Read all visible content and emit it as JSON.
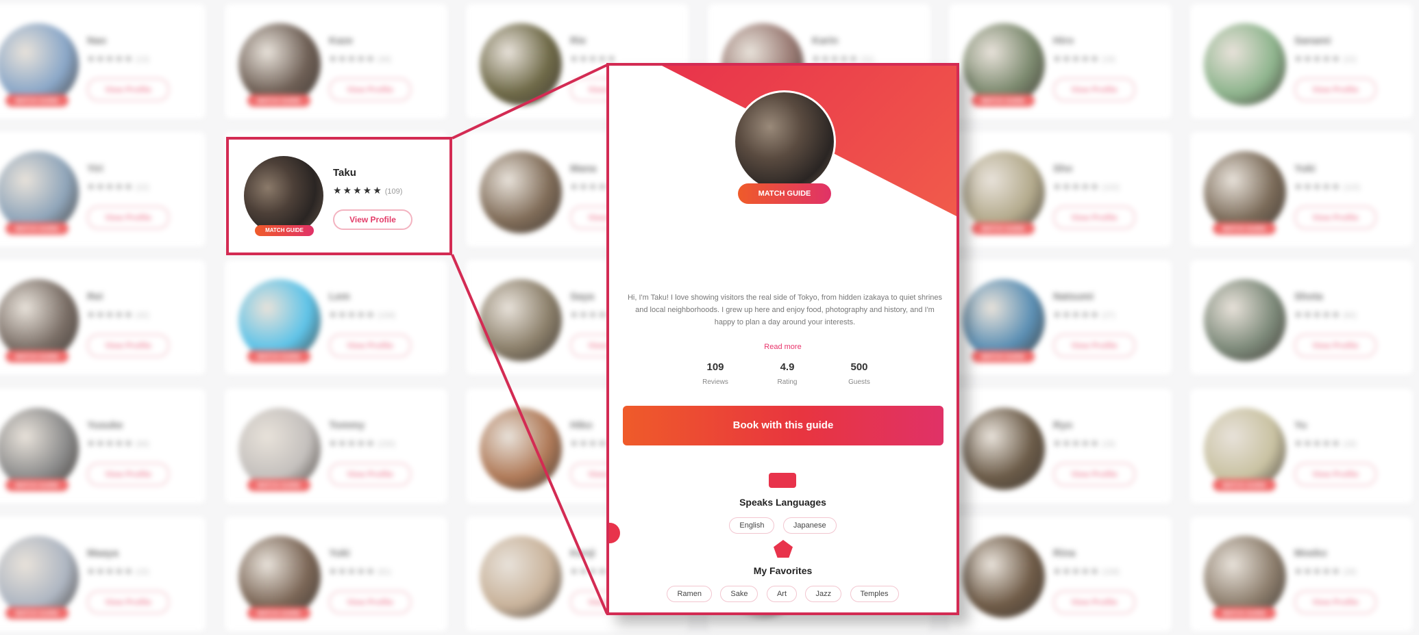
{
  "grid_cards": [
    {
      "name": "Nao",
      "reviews": "(13)",
      "badge": "MATCH GUIDE",
      "color": "#8aa7c8"
    },
    {
      "name": "Kaze",
      "reviews": "(46)",
      "badge": "MATCH GUIDE",
      "color": "#6e5f55"
    },
    {
      "name": "Rie",
      "reviews": "",
      "badge": "",
      "color": "#6f6a48"
    },
    {
      "name": "Karin",
      "reviews": "(31)",
      "badge": "",
      "color": "#9a7b74"
    },
    {
      "name": "Hiro",
      "reviews": "(19)",
      "badge": "MATCH GUIDE",
      "color": "#7c8a6f"
    },
    {
      "name": "Sanami",
      "reviews": "(22)",
      "badge": "",
      "color": "#8fb58e"
    },
    {
      "name": "Yiri",
      "reviews": "(22)",
      "badge": "MATCH GUIDE",
      "color": "#8fa5ba"
    },
    {
      "name": "Taku",
      "reviews": "(109)",
      "badge": "MATCH GUIDE",
      "color": "#4b3f38"
    },
    {
      "name": "Mana",
      "reviews": "",
      "badge": "",
      "color": "#806c58"
    },
    {
      "name": "",
      "reviews": "",
      "badge": "",
      "color": "#ffffff"
    },
    {
      "name": "Sho",
      "reviews": "(102)",
      "badge": "MATCH GUIDE",
      "color": "#b3aa8c"
    },
    {
      "name": "Yuki",
      "reviews": "(115)",
      "badge": "MATCH GUIDE",
      "color": "#7a6a58"
    },
    {
      "name": "Rei",
      "reviews": "(42)",
      "badge": "MATCH GUIDE",
      "color": "#7a6e66"
    },
    {
      "name": "Lem",
      "reviews": "(108)",
      "badge": "MATCH GUIDE",
      "color": "#5ec3e8"
    },
    {
      "name": "Saya",
      "reviews": "",
      "badge": "",
      "color": "#8b7f6a"
    },
    {
      "name": "",
      "reviews": "",
      "badge": "",
      "color": "#ffffff"
    },
    {
      "name": "Natsumi",
      "reviews": "(27)",
      "badge": "MATCH GUIDE",
      "color": "#5b8fb4"
    },
    {
      "name": "Shota",
      "reviews": "(82)",
      "badge": "",
      "color": "#7d8a7a"
    },
    {
      "name": "Yusuke",
      "reviews": "(66)",
      "badge": "MATCH GUIDE",
      "color": "#8c8c8c"
    },
    {
      "name": "Tommy",
      "reviews": "(230)",
      "badge": "MATCH GUIDE",
      "color": "#c4c0bd"
    },
    {
      "name": "Hiko",
      "reviews": "",
      "badge": "",
      "color": "#b07a58"
    },
    {
      "name": "",
      "reviews": "",
      "badge": "",
      "color": "#ffffff"
    },
    {
      "name": "Ryo",
      "reviews": "(18)",
      "badge": "",
      "color": "#6b5b48"
    },
    {
      "name": "Yu",
      "reviews": "(18)",
      "badge": "MATCH GUIDE",
      "color": "#c9c2a2"
    },
    {
      "name": "Maaya",
      "reviews": "(15)",
      "badge": "MATCH GUIDE",
      "color": "#aeb6c2"
    },
    {
      "name": "Yuki",
      "reviews": "(81)",
      "badge": "MATCH GUIDE",
      "color": "#7b6656"
    },
    {
      "name": "Kenji",
      "reviews": "",
      "badge": "",
      "color": "#c9b39b"
    },
    {
      "name": "",
      "reviews": "",
      "badge": "",
      "color": "#ffffff"
    },
    {
      "name": "Rina",
      "reviews": "(108)",
      "badge": "",
      "color": "#6f5b47"
    },
    {
      "name": "Moeko",
      "reviews": "(28)",
      "badge": "MATCH GUIDE",
      "color": "#8c7d6c"
    }
  ],
  "highlight": {
    "name": "Taku",
    "stars": "★★★★★",
    "reviews": "(109)",
    "badge": "MATCH GUIDE",
    "button": "View Profile"
  },
  "grid_common": {
    "stars": "★★★★★",
    "button": "View Profile"
  },
  "profile": {
    "badge": "MATCH GUIDE",
    "bio": "Hi, I'm Taku! I love showing visitors the real side of Tokyo, from hidden izakaya to quiet shrines and local neighborhoods. I grew up here and enjoy food, photography and history, and I'm happy to plan a day around your interests.",
    "read_more": "Read more",
    "stats": [
      {
        "value": "109",
        "label": "Reviews"
      },
      {
        "value": "4.9",
        "label": "Rating"
      },
      {
        "value": "500",
        "label": "Guests"
      }
    ],
    "cta": "Book with this guide",
    "languages_title": "Speaks Languages",
    "languages": [
      "English",
      "Japanese"
    ],
    "favorites_title": "My Favorites",
    "favorites": [
      "Ramen",
      "Sake",
      "Art",
      "Jazz",
      "Temples"
    ]
  },
  "colors": {
    "accent": "#d32b53",
    "gradient_start": "#ef5b2a",
    "gradient_end": "#e03267"
  }
}
